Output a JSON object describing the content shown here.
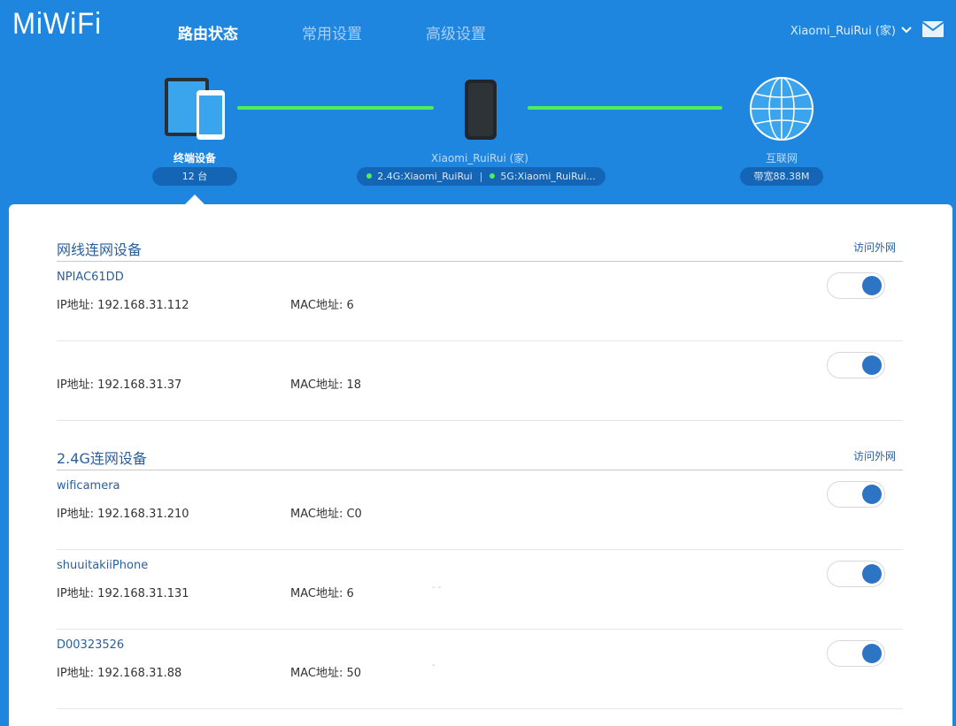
{
  "header": {
    "logo": "MiWiFi",
    "nav": [
      "路由状态",
      "常用设置",
      "高级设置"
    ],
    "user": "Xiaomi_RuiRui (家)"
  },
  "topology": {
    "clients": {
      "label": "终端设备",
      "count": "12 台"
    },
    "router": {
      "name": "Xiaomi_RuiRui (家)",
      "band24": "2.4G:Xiaomi_RuiRui",
      "band5": "5G:Xiaomi_RuiRui..."
    },
    "internet": {
      "label": "互联网",
      "bandwidth": "带宽88.38M"
    }
  },
  "colors": {
    "brand": "#1f86e0",
    "link": "#4df05a",
    "toggle": "#2d74c4"
  },
  "sections": [
    {
      "title": "网线连网设备",
      "action": "访问外网",
      "devices": [
        {
          "name": "NPIAC61DD",
          "ip": "IP地址: 192.168.31.112",
          "mac": "MAC地址: 6",
          "mac_extra": "",
          "enabled": true
        },
        {
          "name": "",
          "ip": "IP地址: 192.168.31.37",
          "mac": "MAC地址: 18",
          "mac_extra": "",
          "enabled": true
        }
      ]
    },
    {
      "title": "2.4G连网设备",
      "action": "访问外网",
      "devices": [
        {
          "name": "wificamera",
          "ip": "IP地址: 192.168.31.210",
          "mac": "MAC地址: C0...",
          "mac_extra": "",
          "enabled": true
        },
        {
          "name": "shuuitakiiPhone",
          "ip": "IP地址: 192.168.31.131",
          "mac": "MAC地址: 6",
          "mac_extra": "- -",
          "enabled": true
        },
        {
          "name": "D00323526",
          "ip": "IP地址: 192.168.31.88",
          "mac": "MAC地址: 50",
          "mac_extra": "-",
          "enabled": true
        }
      ]
    }
  ]
}
